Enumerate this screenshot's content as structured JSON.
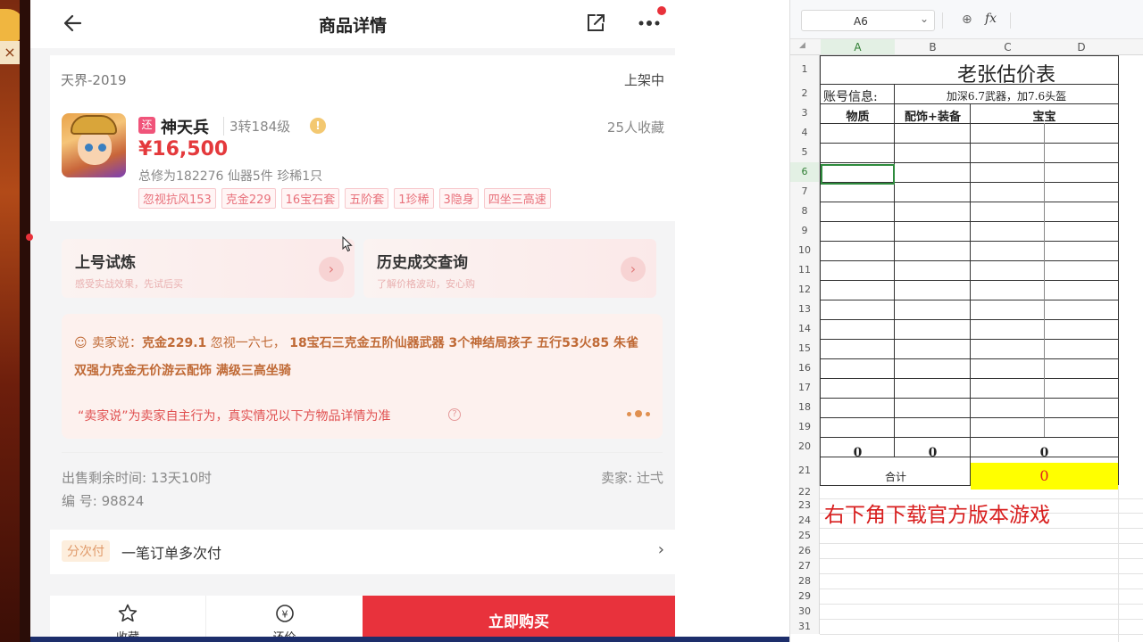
{
  "phone": {
    "title": "商品详情",
    "server": "天界-2019",
    "status": "上架中",
    "character": {
      "return_tag": "还",
      "name": "神天兵",
      "level": "3转184级",
      "favorites": "25人收藏",
      "price": "¥16,500",
      "stats": "总修为182276  仙器5件  珍稀1只",
      "tags": [
        "忽视抗风153",
        "克金229",
        "16宝石套",
        "五阶套",
        "1珍稀",
        "3隐身",
        "四坐三高速"
      ]
    },
    "features": [
      {
        "title": "上号试炼",
        "subtitle": "感受实战效果，先试后买"
      },
      {
        "title": "历史成交查询",
        "subtitle": "了解价格波动，安心购"
      }
    ],
    "seller_says": {
      "prefix": "卖家说：",
      "parts": [
        {
          "text": "克金229.1",
          "bold": true
        },
        {
          "text": "忽视一六七，",
          "bold": false
        },
        {
          "text": "18宝石三克金五阶仙器武器 3个神结局孩子 五行53火85 朱雀 双强力克金无价游云配饰 满级三高坐骑",
          "bold": true
        }
      ],
      "note": "“卖家说”为卖家自主行为，真实情况以下方物品详情为准"
    },
    "sale_remaining": "出售剩余时间: 13天10时",
    "seller": "卖家: 辻弌",
    "item_number": "编  号: 98824",
    "installment": {
      "tag": "分次付",
      "text": "一笔订单多次付"
    },
    "bottom_nav": {
      "favorite": "收藏",
      "offer": "还价",
      "buy": "立即购买"
    }
  },
  "sheet": {
    "name_box": "A6",
    "fx": "fx",
    "columns": [
      "A",
      "B",
      "C",
      "D"
    ],
    "rows": [
      "1",
      "2",
      "3",
      "4",
      "5",
      "6",
      "7",
      "8",
      "9",
      "10",
      "11",
      "12",
      "13",
      "14",
      "15",
      "16",
      "17",
      "18",
      "19",
      "20",
      "21",
      "22",
      "23",
      "24",
      "25",
      "26",
      "27",
      "28",
      "29",
      "30",
      "31"
    ],
    "title": "老张估价表",
    "account_label": "账号信息:",
    "account_info": "加深6.7武器，加7.6头盔",
    "headers": [
      "物质",
      "配饰+装备",
      "宝宝"
    ],
    "row20": [
      "0",
      "0",
      "0"
    ],
    "total_label": "合计",
    "total_value": "0",
    "banner": "右下角下载官方版本游戏"
  }
}
